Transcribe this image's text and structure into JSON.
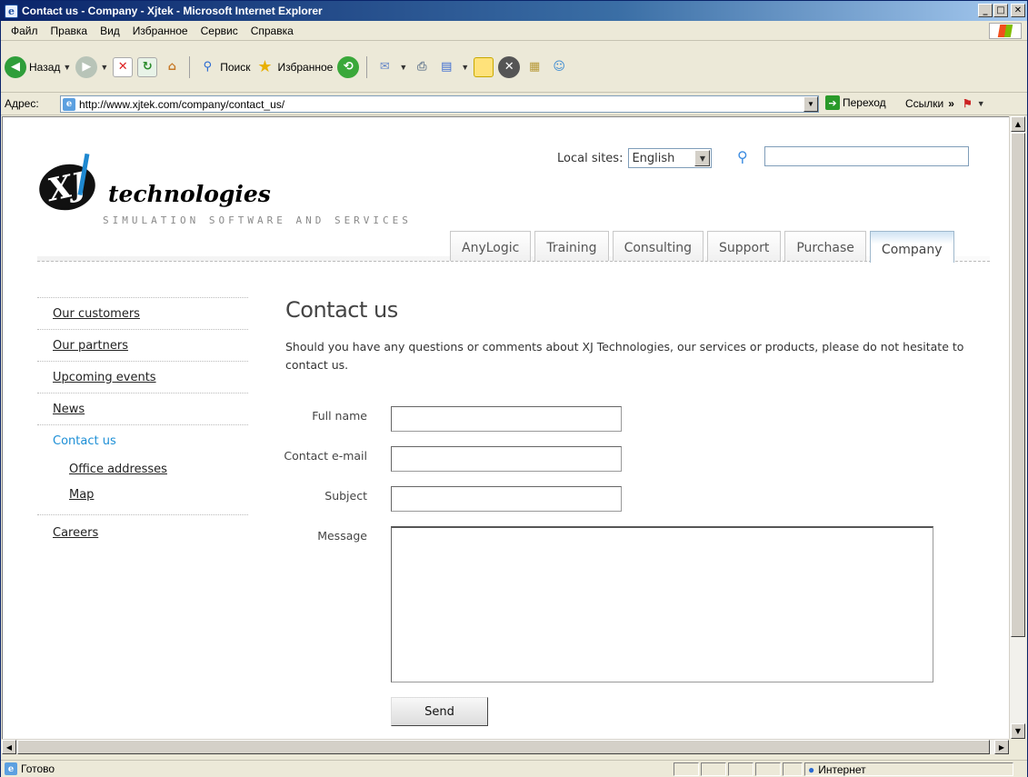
{
  "window": {
    "title": "Contact us - Company - Xjtek - Microsoft Internet Explorer",
    "buttons": [
      "_",
      "□",
      "✕"
    ]
  },
  "menubar": {
    "items": [
      "Файл",
      "Правка",
      "Вид",
      "Избранное",
      "Сервис",
      "Справка"
    ]
  },
  "toolbar": {
    "back_label": "Назад",
    "search_label": "Поиск",
    "favorites_label": "Избранное"
  },
  "addressbar": {
    "label": "Адрес:",
    "url": "http://www.xjtek.com/company/contact_us/",
    "go_label": "Переход",
    "links_label": "Ссылки",
    "links_chevron": "»"
  },
  "page": {
    "logo": {
      "wordmark": "technologies",
      "tagline": "SIMULATION SOFTWARE AND SERVICES"
    },
    "local_sites": {
      "label": "Local sites:",
      "selected": "English"
    },
    "tabs": [
      {
        "label": "AnyLogic",
        "active": false
      },
      {
        "label": "Training",
        "active": false
      },
      {
        "label": "Consulting",
        "active": false
      },
      {
        "label": "Support",
        "active": false
      },
      {
        "label": "Purchase",
        "active": false
      },
      {
        "label": "Company",
        "active": true
      }
    ],
    "leftnav": [
      {
        "label": "Our customers"
      },
      {
        "label": "Our partners"
      },
      {
        "label": "Upcoming events"
      },
      {
        "label": "News"
      },
      {
        "label": "Contact us",
        "active": true
      },
      {
        "label": "Office addresses",
        "sub": true
      },
      {
        "label": "Map",
        "sub": true
      },
      {
        "label": "Careers"
      }
    ],
    "heading": "Contact us",
    "intro": "Should you have any questions or comments about XJ Technologies, our services or products, please do not hesitate to contact us.",
    "form": {
      "full_name_label": "Full name",
      "email_label": "Contact e-mail",
      "subject_label": "Subject",
      "message_label": "Message",
      "full_name_value": "",
      "email_value": "",
      "subject_value": "",
      "message_value": "",
      "send_label": "Send"
    }
  },
  "statusbar": {
    "status_text": "Готово",
    "zone_text": "Интернет"
  },
  "colors": {
    "accent_link": "#1d8fd6",
    "titlebar": "#0a246a",
    "active_tab": "#cfe3f3"
  }
}
